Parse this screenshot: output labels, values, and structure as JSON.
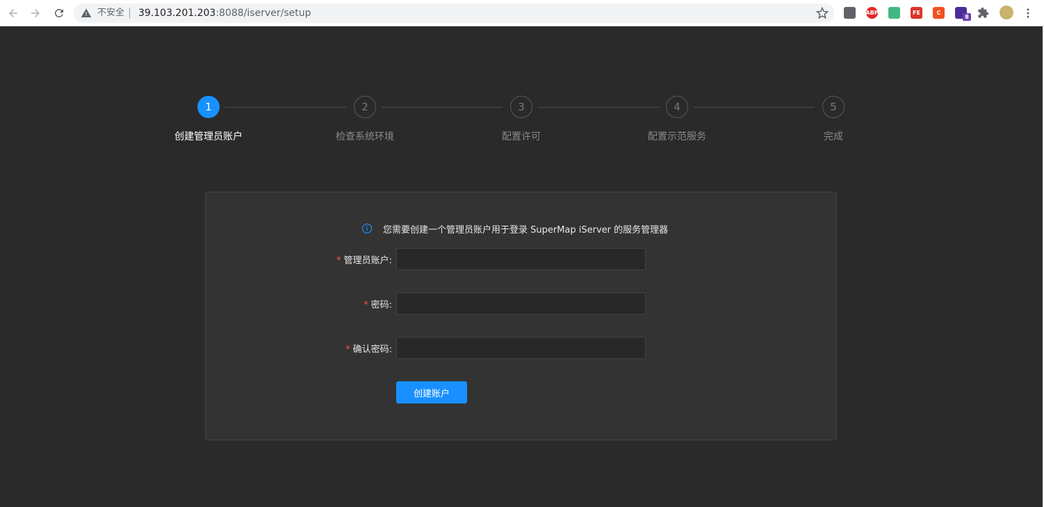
{
  "browser": {
    "security_text": "不安全",
    "url_host": "39.103.201.203",
    "url_path": ":8088/iserver/setup",
    "extensions": [
      {
        "name": "screenshot-ext-icon",
        "label": "",
        "color": "#5f6368"
      },
      {
        "name": "adblock-plus-icon",
        "label": "ABP",
        "color": "#e6282d"
      },
      {
        "name": "vue-devtools-icon",
        "label": "",
        "color": "#41b883"
      },
      {
        "name": "fe-helper-icon",
        "label": "FE",
        "color": "#d9342b"
      },
      {
        "name": "c-ext-icon",
        "label": "C",
        "color": "#f4511e"
      },
      {
        "name": "purple-ext-icon",
        "label": "",
        "color": "#4a2d9a",
        "badge": "8"
      },
      {
        "name": "extensions-puzzle-icon",
        "label": "",
        "color": "#5f6368"
      },
      {
        "name": "profile-avatar-icon",
        "label": "",
        "color": "#c9b26a"
      }
    ]
  },
  "steps": [
    {
      "number": "1",
      "label": "创建管理员账户",
      "active": true
    },
    {
      "number": "2",
      "label": "检查系统环境",
      "active": false
    },
    {
      "number": "3",
      "label": "配置许可",
      "active": false
    },
    {
      "number": "4",
      "label": "配置示范服务",
      "active": false
    },
    {
      "number": "5",
      "label": "完成",
      "active": false
    }
  ],
  "form": {
    "info": "您需要创建一个管理员账户用于登录 SuperMap iServer 的服务管理器",
    "required_mark": "*",
    "fields": [
      {
        "label": "管理员账户:",
        "value": ""
      },
      {
        "label": "密码:",
        "value": ""
      },
      {
        "label": "确认密码:",
        "value": ""
      }
    ],
    "submit_label": "创建账户"
  },
  "colors": {
    "accent": "#1890ff",
    "background": "#2a2a2a",
    "card": "#333333",
    "required": "#ff4d4f"
  }
}
